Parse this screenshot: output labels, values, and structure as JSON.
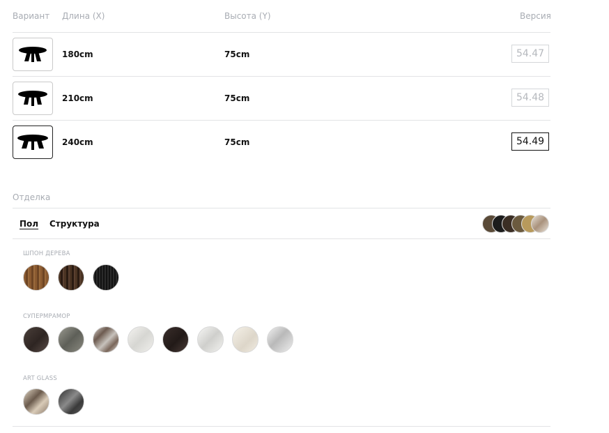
{
  "headers": {
    "variant": "Вариант",
    "length": "Длина (X)",
    "height": "Высота (Y)",
    "version": "Версия"
  },
  "rows": [
    {
      "length": "180cm",
      "height": "75cm",
      "version": "54.47",
      "selected": false
    },
    {
      "length": "210cm",
      "height": "75cm",
      "version": "54.48",
      "selected": false
    },
    {
      "length": "240cm",
      "height": "75cm",
      "version": "54.49",
      "selected": true
    }
  ],
  "finish": {
    "title": "Отделка",
    "tabs": [
      {
        "label": "Пол",
        "active": true
      },
      {
        "label": "Структура",
        "active": false
      }
    ],
    "preview_colors": [
      "#5a4a38",
      "#1c1c1c",
      "#3b2e24",
      "#6b5a3e",
      "#b89a5c",
      "#cbbfae"
    ],
    "groups": [
      {
        "label": "ШПОН ДЕРЕВА",
        "swatches": [
          {
            "name": "wood-light",
            "colors": [
              "#8a5a30",
              "#5c3a1e"
            ]
          },
          {
            "name": "wood-dark",
            "colors": [
              "#4a3322",
              "#2a1b12"
            ]
          },
          {
            "name": "wood-black",
            "colors": [
              "#2b2b2b",
              "#121212"
            ]
          }
        ]
      },
      {
        "label": "СУПЕРМРАМОР",
        "swatches": [
          {
            "name": "marble-dark-brown",
            "colors": [
              "#4a3f3a",
              "#2e2522"
            ]
          },
          {
            "name": "marble-grey-green",
            "colors": [
              "#8a8a80",
              "#5e5f58"
            ]
          },
          {
            "name": "marble-patterned",
            "colors": [
              "#c7c2bc",
              "#6d5b50"
            ]
          },
          {
            "name": "marble-white-veined",
            "colors": [
              "#f0efec",
              "#d6d6d2"
            ]
          },
          {
            "name": "marble-dark",
            "colors": [
              "#3a2e2b",
              "#221a18"
            ]
          },
          {
            "name": "marble-white-grey",
            "colors": [
              "#f2f2f0",
              "#cfcfcc"
            ]
          },
          {
            "name": "marble-cream",
            "colors": [
              "#f1ece2",
              "#ddd6c9"
            ]
          },
          {
            "name": "marble-white-silver",
            "colors": [
              "#eeeeee",
              "#b9b9b9"
            ]
          }
        ]
      },
      {
        "label": "ART GLASS",
        "swatches": [
          {
            "name": "glass-light",
            "colors": [
              "#d9cbb8",
              "#6a5a4c"
            ]
          },
          {
            "name": "glass-dark",
            "colors": [
              "#3a3a3a",
              "#8a8a8a"
            ]
          }
        ]
      }
    ]
  }
}
